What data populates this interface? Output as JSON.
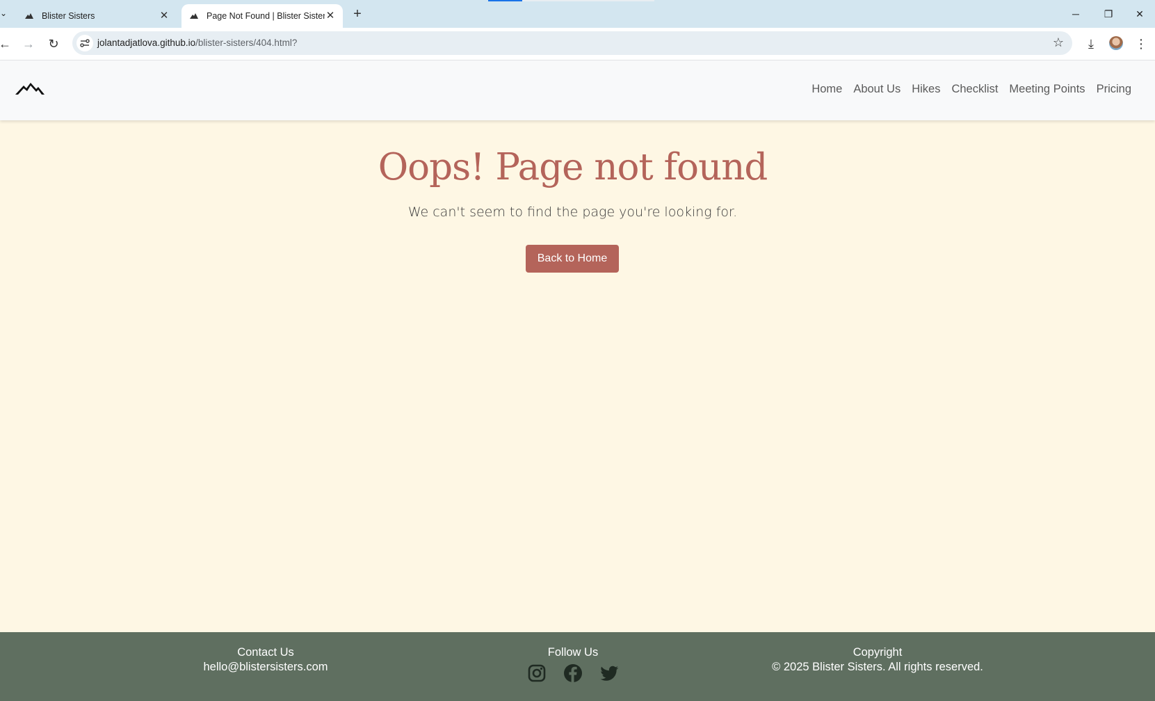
{
  "browser": {
    "tabs": [
      {
        "title": "Blister Sisters",
        "active": false
      },
      {
        "title": "Page Not Found | Blister Sisters",
        "active": true
      }
    ],
    "url_host": "jolantadjatlova.github.io",
    "url_path": "/blister-sisters/404.html?"
  },
  "nav": {
    "links": [
      "Home",
      "About Us",
      "Hikes",
      "Checklist",
      "Meeting Points",
      "Pricing"
    ]
  },
  "main": {
    "heading": "Oops! Page not found",
    "subtext": "We can't seem to find the page you're looking for.",
    "button_label": "Back to Home"
  },
  "footer": {
    "contact_title": "Contact Us",
    "contact_email": "hello@blistersisters.com",
    "follow_title": "Follow Us",
    "socials": [
      "instagram-icon",
      "facebook-icon",
      "twitter-icon"
    ],
    "copyright_title": "Copyright",
    "copyright_text": "© 2025 Blister Sisters. All rights reserved."
  },
  "colors": {
    "accent": "#b4645a",
    "background": "#fef7e4",
    "footer": "#5f6f60"
  }
}
